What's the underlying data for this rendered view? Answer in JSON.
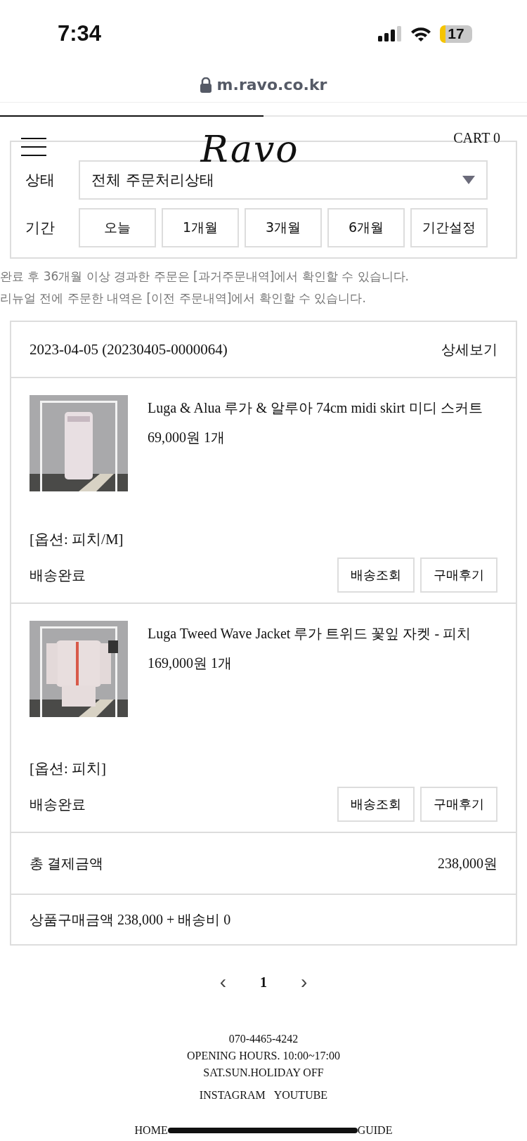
{
  "status_bar": {
    "time": "7:34",
    "battery": "17"
  },
  "browser": {
    "url": "m.ravo.co.kr"
  },
  "header": {
    "logo": "Ravo",
    "cart": "CART 0"
  },
  "filter": {
    "status_label": "상태",
    "status_value": "전체 주문처리상태",
    "period_label": "기간",
    "periods": [
      {
        "label": "오늘",
        "selected": false
      },
      {
        "label": "1개월",
        "selected": false
      },
      {
        "label": "3개월",
        "selected": false
      },
      {
        "label": "6개월",
        "selected": false
      },
      {
        "label": "기간설정",
        "selected": false
      }
    ]
  },
  "notes": [
    "완료 후 36개월 이상 경과한 주문은 [과거주문내역]에서 확인할 수 있습니다.",
    "리뉴얼 전에 주문한 내역은 [이전 주문내역]에서 확인할 수 있습니다."
  ],
  "order": {
    "date": "2023-04-05 (20230405-0000064)",
    "detail_link": "상세보기",
    "items": [
      {
        "name": "Luga & Alua 루가 & 알루아 74cm midi skirt 미디 스커트",
        "price": "69,000원 1개",
        "option": "[옵션: 피치/M]",
        "status": "배송완료",
        "buttons": [
          "배송조회",
          "구매후기"
        ]
      },
      {
        "name": "Luga Tweed Wave Jacket 루가 트위드 꽃잎 자켓 - 피치",
        "price": "169,000원 1개",
        "option": "[옵션: 피치]",
        "status": "배송완료",
        "buttons": [
          "배송조회",
          "구매후기"
        ]
      }
    ],
    "total_label": "총 결제금액",
    "total_value": "238,000원",
    "breakdown": "상품구매금액 238,000 + 배송비 0"
  },
  "pagination": {
    "prev": "‹",
    "pages": [
      {
        "label": "1",
        "selected": true
      }
    ],
    "next": "›"
  },
  "footer": {
    "phone": "070-4465-4242",
    "hours": "OPENING HOURS. 10:00~17:00",
    "off": "SAT.SUN.HOLIDAY OFF",
    "social": [
      "INSTAGRAM",
      "YOUTUBE"
    ],
    "links": [
      "HOME",
      "GUIDE"
    ]
  }
}
